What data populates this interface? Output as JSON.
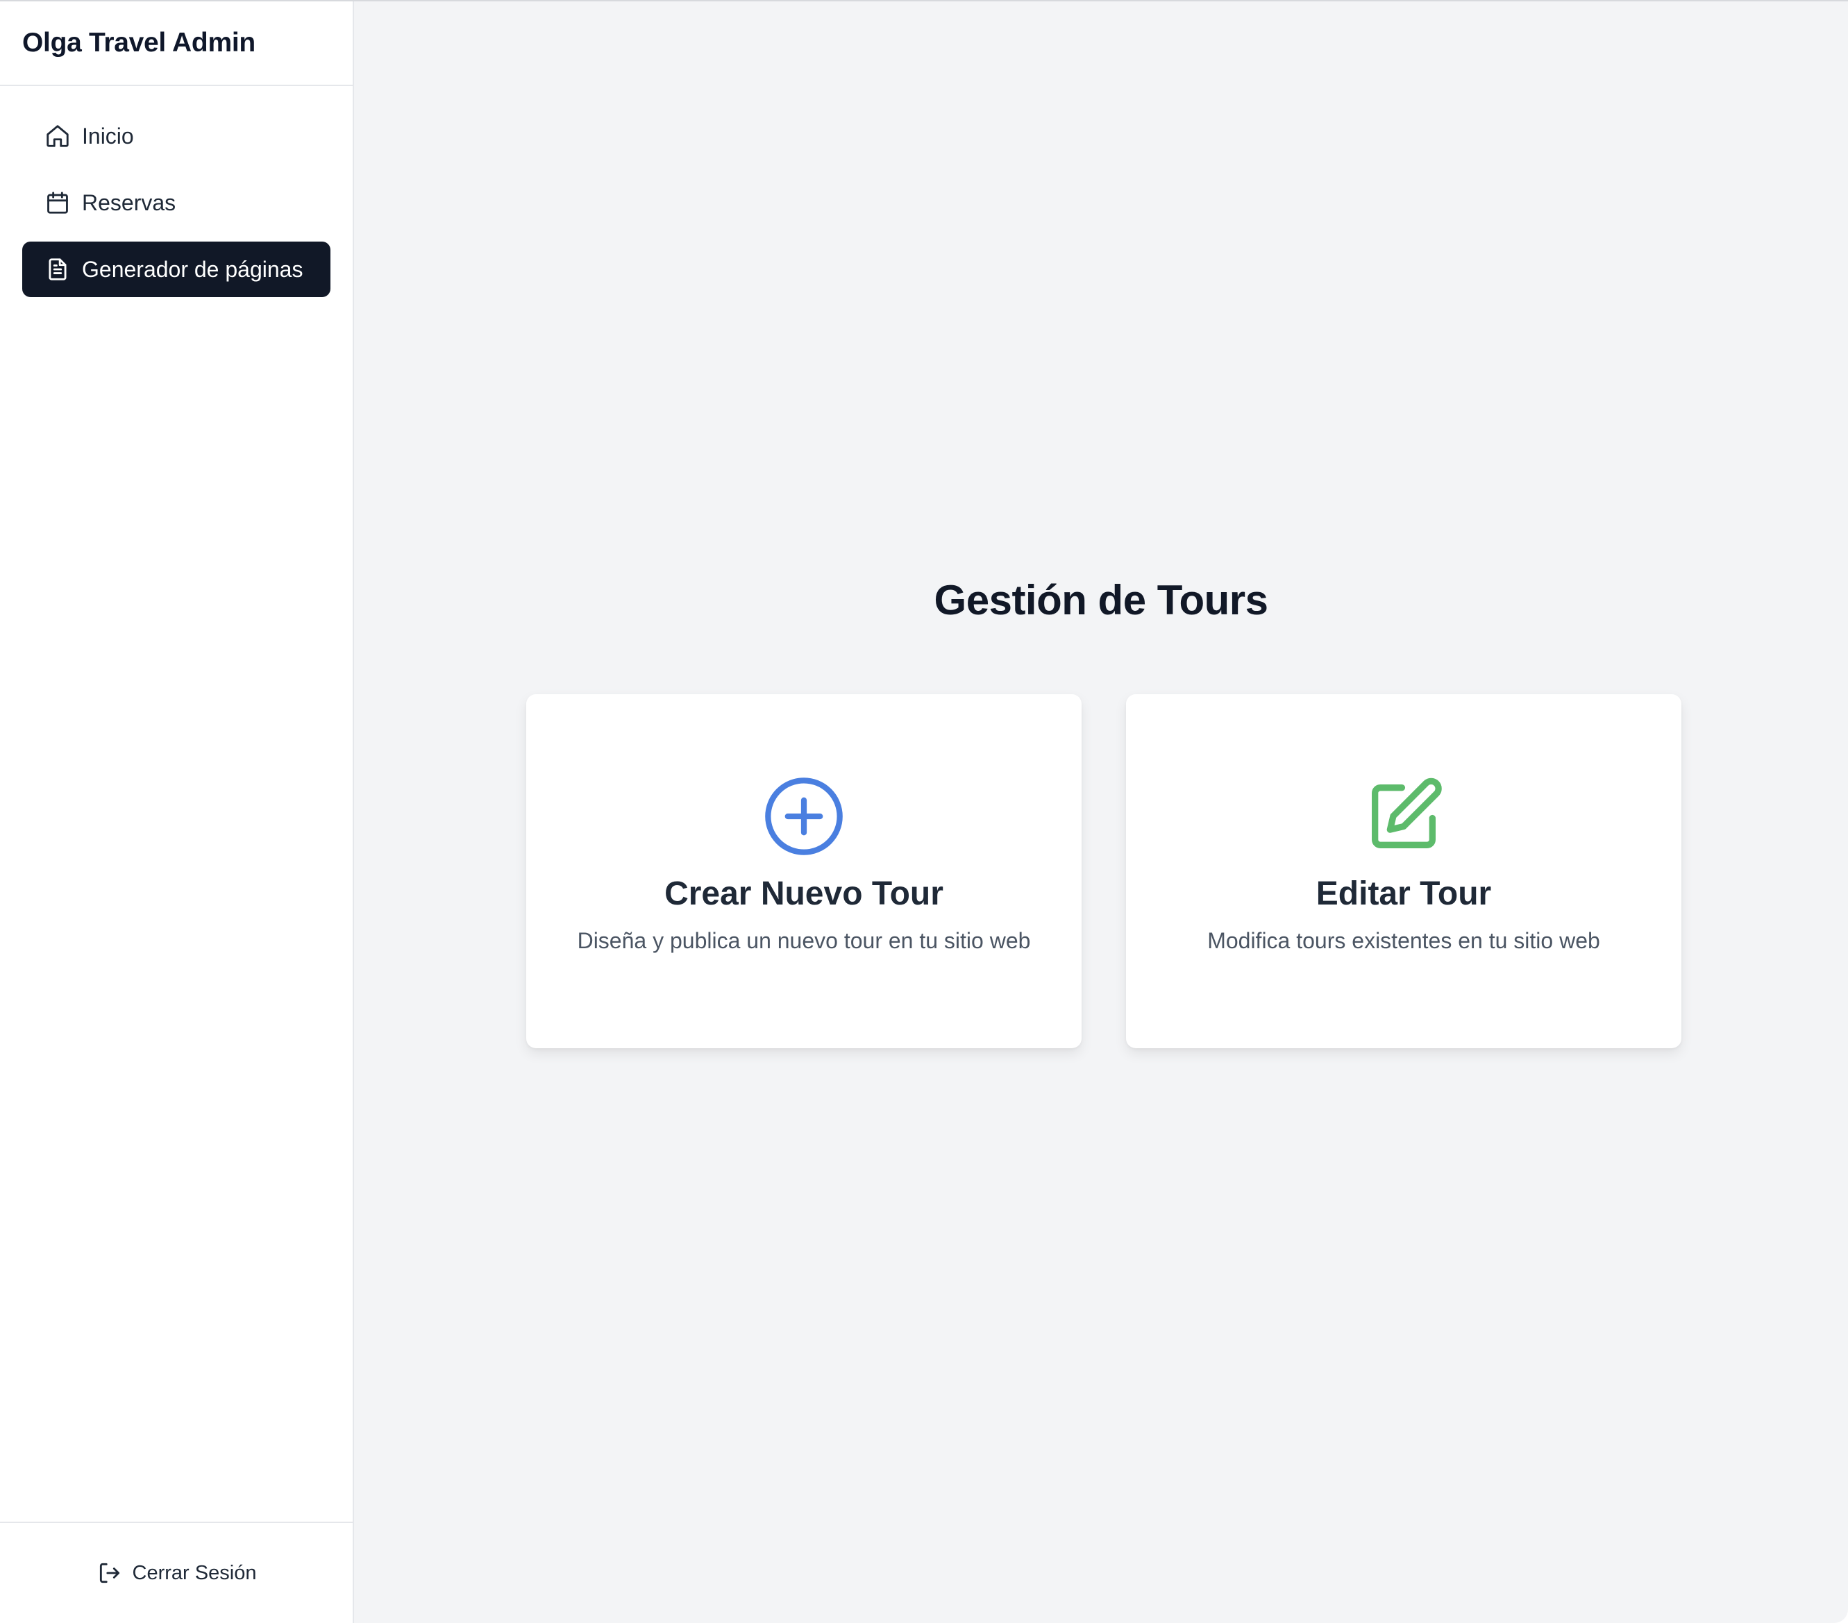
{
  "sidebar": {
    "brand": "Olga Travel Admin",
    "items": [
      {
        "label": "Inicio",
        "icon": "home-icon",
        "active": false
      },
      {
        "label": "Reservas",
        "icon": "calendar-icon",
        "active": false
      },
      {
        "label": "Generador de páginas",
        "icon": "document-icon",
        "active": true
      }
    ],
    "logout_label": "Cerrar Sesión"
  },
  "main": {
    "title": "Gestión de Tours",
    "cards": [
      {
        "title": "Crear Nuevo Tour",
        "description": "Diseña y publica un nuevo tour en tu sitio web",
        "icon": "plus-circle-icon",
        "color": "#4a7fe0"
      },
      {
        "title": "Editar Tour",
        "description": "Modifica tours existentes en tu sitio web",
        "icon": "edit-icon",
        "color": "#5dbb6b"
      }
    ]
  },
  "colors": {
    "active_bg": "#111827",
    "main_bg": "#f3f4f6"
  }
}
